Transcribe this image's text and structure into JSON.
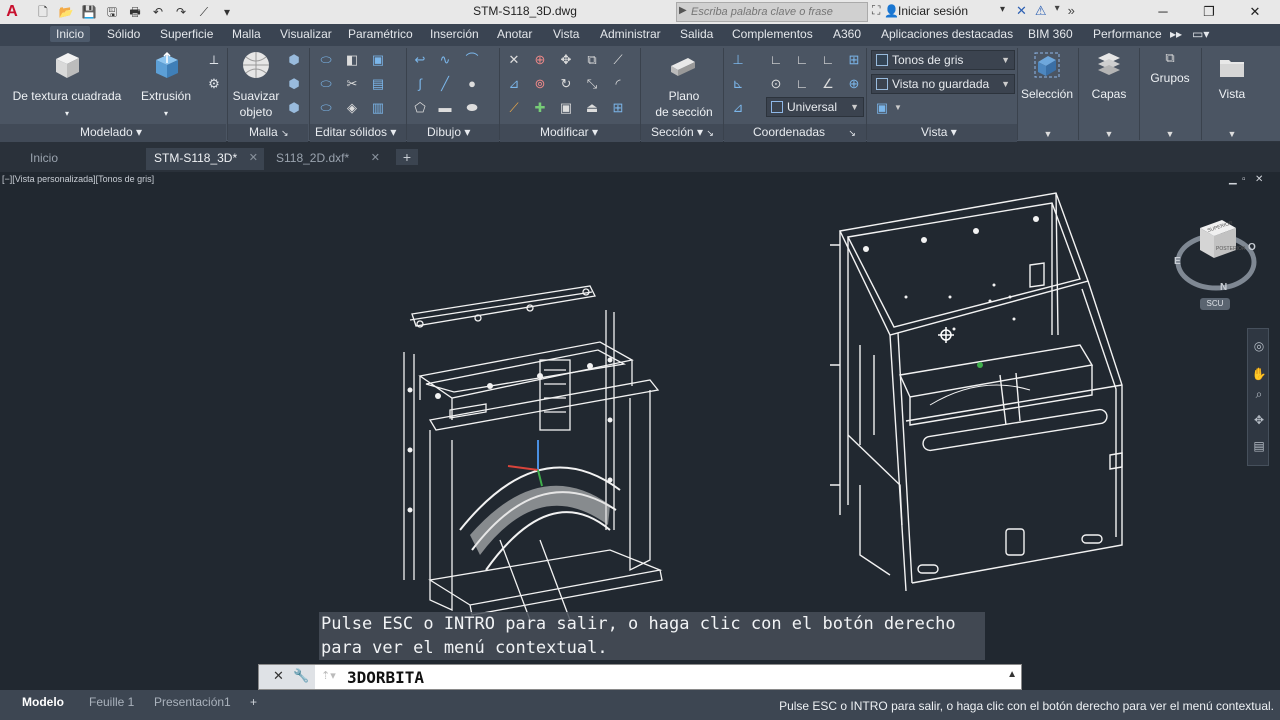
{
  "titlebar": {
    "logo": "A",
    "title": "STM-S118_3D.dwg",
    "search_placeholder": "Escriba palabra clave o frase",
    "signin": "Iniciar sesión"
  },
  "ribbon_tabs": [
    {
      "label": "Inicio",
      "active": true
    },
    {
      "label": "Sólido"
    },
    {
      "label": "Superficie"
    },
    {
      "label": "Malla"
    },
    {
      "label": "Visualizar"
    },
    {
      "label": "Paramétrico"
    },
    {
      "label": "Inserción"
    },
    {
      "label": "Anotar"
    },
    {
      "label": "Vista"
    },
    {
      "label": "Administrar"
    },
    {
      "label": "Salida"
    },
    {
      "label": "Complementos"
    },
    {
      "label": "A360"
    },
    {
      "label": "Aplicaciones destacadas"
    },
    {
      "label": "BIM 360"
    },
    {
      "label": "Performance"
    }
  ],
  "ribbon": {
    "btn_textura_1": "De textura cuadrada",
    "btn_extrusion": "Extrusión",
    "btn_suavizar_1": "Suavizar",
    "btn_suavizar_2": "objeto",
    "btn_plano_1": "Plano",
    "btn_plano_2": "de sección",
    "btn_seleccion": "Selección",
    "btn_capas": "Capas",
    "btn_grupos": "Grupos",
    "btn_vista": "Vista",
    "visual_style": "Tonos de gris",
    "view_state": "Vista no guardada",
    "ucs": "Universal",
    "panels": {
      "modelado": "Modelado",
      "malla": "Malla",
      "editar_solidos": "Editar sólidos",
      "dibujo": "Dibujo",
      "modificar": "Modificar",
      "seccion": "Sección",
      "coordenadas": "Coordenadas",
      "vista": "Vista"
    }
  },
  "doc_tabs": [
    {
      "label": "Inicio"
    },
    {
      "label": "STM-S118_3D*",
      "active": true
    },
    {
      "label": "S118_2D.dxf*"
    }
  ],
  "viewport": {
    "label": "[−][Vista personalizada][Tonos de gris]",
    "viewcube_label": "SCU"
  },
  "command": {
    "history_line1": "Pulse ESC o INTRO para salir, o haga clic con el botón derecho",
    "history_line2": "para ver el menú contextual.",
    "current": "3DORBITA"
  },
  "layout_tabs": [
    {
      "label": "Modelo",
      "active": true
    },
    {
      "label": "Feuille 1"
    },
    {
      "label": "Presentación1"
    }
  ],
  "status_message": "Pulse ESC o INTRO para salir, o haga clic con el botón derecho para ver el menú contextual."
}
